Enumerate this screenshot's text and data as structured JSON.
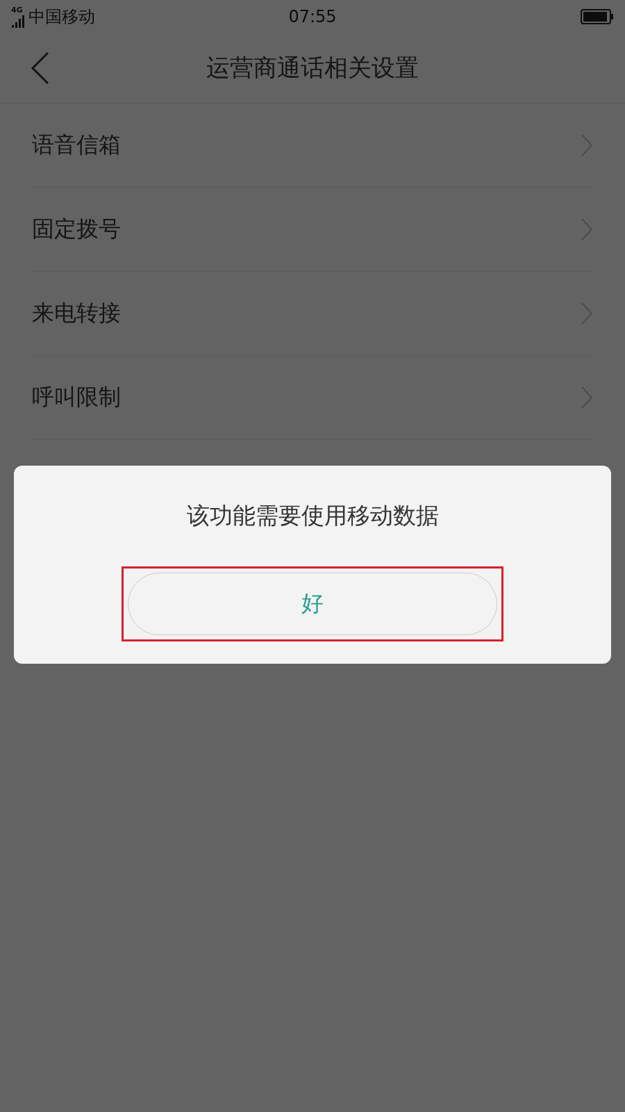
{
  "status_bar": {
    "network": "4G",
    "carrier": "中国移动",
    "time": "07:55"
  },
  "header": {
    "title": "运营商通话相关设置"
  },
  "items": [
    {
      "label": "语音信箱"
    },
    {
      "label": "固定拨号"
    },
    {
      "label": "来电转接"
    },
    {
      "label": "呼叫限制"
    }
  ],
  "dialog": {
    "message": "该功能需要使用移动数据",
    "button": "好",
    "highlighted": true
  }
}
